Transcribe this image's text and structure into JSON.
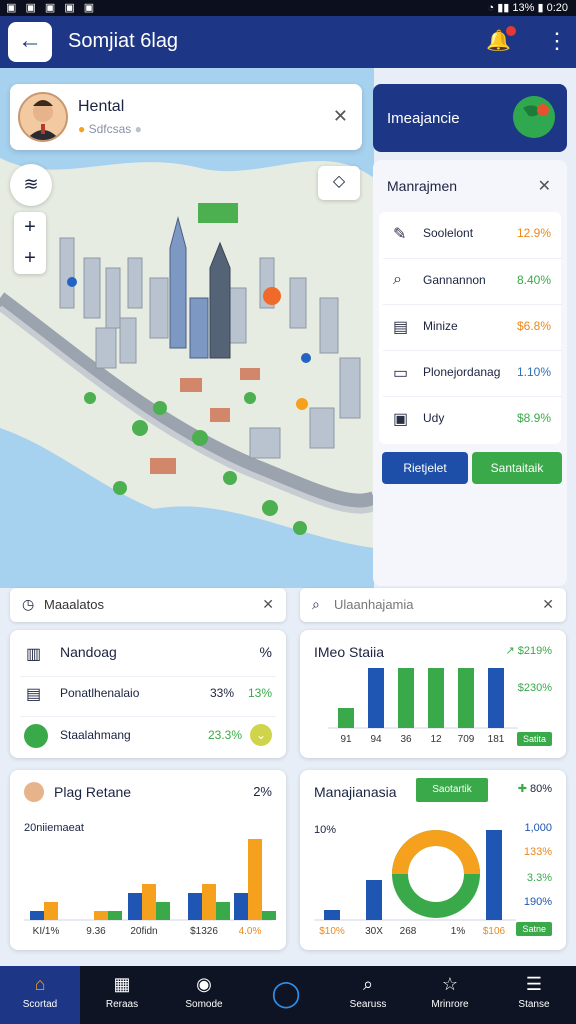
{
  "status": {
    "left": "▣ ▣ ▣ ▣ ▣",
    "right": "◔ ▮▮ 13% ▮ 0:20"
  },
  "header": {
    "title": "Somjiat 6lag"
  },
  "profile": {
    "name": "Hental",
    "subtitle": "Sdfcsas"
  },
  "info_tile": {
    "label": "Imeajancie"
  },
  "side_panel": {
    "title": "Manrajmen",
    "rows": [
      {
        "icon": "pen-icon",
        "glyph": "✎",
        "label": "Soolelont",
        "value": "12.9%",
        "color": "#e8891d"
      },
      {
        "icon": "search-icon",
        "glyph": "⌕",
        "label": "Gannannon",
        "value": "8.40%",
        "color": "#3aa94a"
      },
      {
        "icon": "layers-icon",
        "glyph": "▤",
        "label": "Minize",
        "value": "$6.8%",
        "color": "#e8891d"
      },
      {
        "icon": "folder-icon",
        "glyph": "▭",
        "label": "Plonejordanag",
        "value": "1.10%",
        "color": "#2f6fb5"
      },
      {
        "icon": "calendar-icon",
        "glyph": "▣",
        "label": "Udy",
        "value": "$8.9%",
        "color": "#3aa94a"
      }
    ],
    "btn_primary": "Rietjelet",
    "btn_secondary": "Santaitaik"
  },
  "search_left": {
    "text": "Maaalatos"
  },
  "search_right": {
    "placeholder": "Ulaanhajamia"
  },
  "card_a": {
    "title": "Nandoag",
    "pct": "%",
    "row1": {
      "label": "Ponatlhenalaio",
      "v1": "33%",
      "v2": "13%"
    },
    "row2": {
      "label": "Staalahmang",
      "value": "23.3%"
    }
  },
  "card_b": {
    "title": "IMeo Staiia",
    "delta": "$219%",
    "side_value": "$230%",
    "badge": "Satita"
  },
  "card_c": {
    "title": "Plag Retane",
    "pct": "2%",
    "subtitle": "20niiemaeat"
  },
  "card_d": {
    "title": "Manajianasia",
    "button": "Saotartik",
    "delta": "80%",
    "ylabel": "10%",
    "side_values": [
      "1,000",
      "133%",
      "3.3%",
      "190%"
    ],
    "badge": "Satne"
  },
  "chart_data": [
    {
      "type": "bar",
      "title": "IMeo Staiia",
      "categories": [
        "91",
        "94",
        "36",
        "12",
        "709",
        "181"
      ],
      "series": [
        {
          "values": [
            2,
            6,
            6,
            6,
            6,
            6
          ]
        }
      ],
      "colors": [
        "#3aa94a",
        "#1f56b3",
        "#3aa94a",
        "#3aa94a",
        "#3aa94a",
        "#1f56b3"
      ]
    },
    {
      "type": "bar",
      "title": "Plag Retane",
      "categories": [
        "KI/1%",
        "9.36",
        "20fidn",
        "$1326",
        "4.0%"
      ],
      "series": [
        {
          "values": [
            1,
            0,
            3,
            3,
            3
          ]
        },
        {
          "values": [
            2,
            1,
            4,
            4,
            9
          ]
        },
        {
          "values": [
            0,
            1,
            2,
            2,
            1
          ]
        }
      ],
      "colors": [
        "#1f56b3",
        "#f5a11d",
        "#3aa94a"
      ]
    },
    {
      "type": "bar",
      "title": "Manajianasia",
      "categories": [
        "$10%",
        "30X",
        "268",
        "1%",
        "$106"
      ],
      "series": [
        {
          "values": [
            1,
            4,
            6,
            7,
            9
          ]
        }
      ],
      "colors": [
        "#1f56b3",
        "#1f56b3",
        "#3aa94a",
        "#f5a11d",
        "#1f56b3"
      ]
    }
  ],
  "nav": [
    {
      "icon": "home-icon",
      "glyph": "⌂",
      "label": "Scortad"
    },
    {
      "icon": "grid-icon",
      "glyph": "▦",
      "label": "Reraas"
    },
    {
      "icon": "pin-icon",
      "glyph": "◉",
      "label": "Somode"
    },
    {
      "icon": "assistant-icon",
      "glyph": "◯",
      "label": ""
    },
    {
      "icon": "search-icon",
      "glyph": "⌕",
      "label": "Searuss"
    },
    {
      "icon": "star-icon",
      "glyph": "☆",
      "label": "Mrinrore"
    },
    {
      "icon": "menu-icon",
      "glyph": "☰",
      "label": "Stanse"
    }
  ]
}
